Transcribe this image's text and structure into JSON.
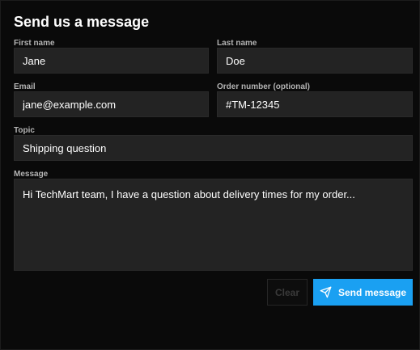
{
  "form": {
    "title": "Send us a message",
    "first_name": {
      "label": "First name",
      "value": "Jane"
    },
    "last_name": {
      "label": "Last name",
      "value": "Doe"
    },
    "email": {
      "label": "Email",
      "value": "jane@example.com"
    },
    "order_number": {
      "label": "Order number (optional)",
      "value": "#TM-12345"
    },
    "topic": {
      "label": "Topic",
      "value": "Shipping question"
    },
    "message": {
      "label": "Message",
      "value": "Hi TechMart team, I have a question about delivery times for my order..."
    },
    "clear_label": "Clear",
    "send_label": "Send message"
  },
  "icons": {
    "send": "paper-plane-icon"
  },
  "colors": {
    "background": "#0a0a0a",
    "field": "#232323",
    "accent": "#1aa0f2"
  }
}
